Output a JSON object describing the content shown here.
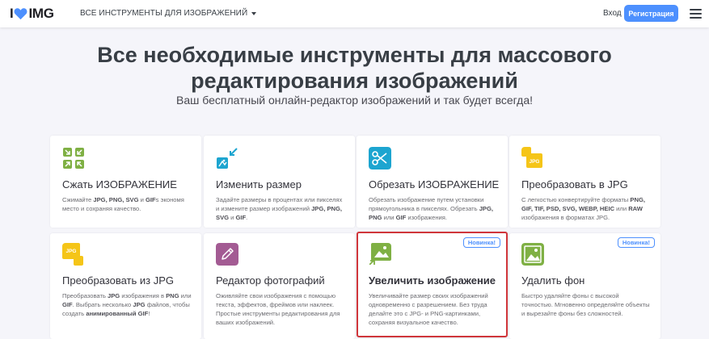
{
  "header": {
    "logo_left": "I",
    "logo_right": "IMG",
    "tools_menu": "ВСЕ ИНСТРУМЕНТЫ ДЛЯ ИЗОБРАЖЕНИЙ",
    "login": "Вход",
    "register": "Регистрация"
  },
  "hero": {
    "title_line1": "Все необходимые инструменты для массового",
    "title_line2": "редактирования изображений",
    "subtitle": "Ваш бесплатный онлайн-редактор изображений и так будет всегда!"
  },
  "tools": [
    {
      "title": "Сжать ИЗОБРАЖЕНИЕ",
      "icon": "compress-icon",
      "color": "#7fb044",
      "desc": [
        "Сжимайте ",
        "JPG, PNG, SVG",
        " и ",
        "GIF",
        "s экономя место и сохраняя качество."
      ]
    },
    {
      "title": "Изменить размер",
      "icon": "resize-icon",
      "color": "#1da5d0",
      "desc": [
        "Задайте размеры в процентах или пикселях и измените размер изображений ",
        "JPG, PNG, SVG",
        " и ",
        "GIF",
        "."
      ]
    },
    {
      "title": "Обрезать ИЗОБРАЖЕНИЕ",
      "icon": "scissors-icon",
      "color": "#1da5d0",
      "desc": [
        "Обрезать изображение путем установки прямоугольника в пикселях. Обрезать ",
        "JPG, PNG",
        " или ",
        "GIF",
        " изображения."
      ]
    },
    {
      "title": "Преобразовать в JPG",
      "icon": "convert-to-jpg-icon",
      "color": "#f5c518",
      "desc": [
        "С легкостью конвертируйте форматы ",
        "PNG, GIF, TIF, PSD, SVG, WEBP, HEIC",
        " или ",
        "RAW",
        " изображения в форматах JPG."
      ]
    },
    {
      "title": "Преобразовать из JPG",
      "icon": "convert-from-jpg-icon",
      "color": "#f5c518",
      "desc": [
        "Преобразовать ",
        "JPG",
        " изображения в ",
        "PNG",
        " или ",
        "GIF",
        ". Выбрать несколько ",
        "JPG",
        " файлов, чтобы создать ",
        "анимированный GIF",
        "!"
      ]
    },
    {
      "title": "Редактор фотографий",
      "icon": "pencil-icon",
      "color": "#a35b93",
      "desc": [
        "Оживляйте свои изображения с помощью текста, эффектов, фреймов или наклеек. Простые инструменты редактирования для ваших изображений."
      ]
    },
    {
      "title": "Увеличить изображение",
      "icon": "upscale-icon",
      "color": "#7fb044",
      "badge": "Новинка!",
      "desc": [
        "Увеличивайте размер своих изображений одновременно с разрешением. Без труда делайте это с JPG- и PNG-картинками, сохраняя визуальное качество."
      ]
    },
    {
      "title": "Удалить фон",
      "icon": "remove-background-icon",
      "color": "#7fb044",
      "badge": "Новинка!",
      "desc": [
        "Быстро удаляйте фоны с высокой точностью. Мгновенно определяйте объекты и вырезайте фоны без сложностей."
      ]
    }
  ],
  "colors": {
    "accent": "#4d90fe",
    "heart": "#4d90fe",
    "active_border": "#d0363b"
  }
}
